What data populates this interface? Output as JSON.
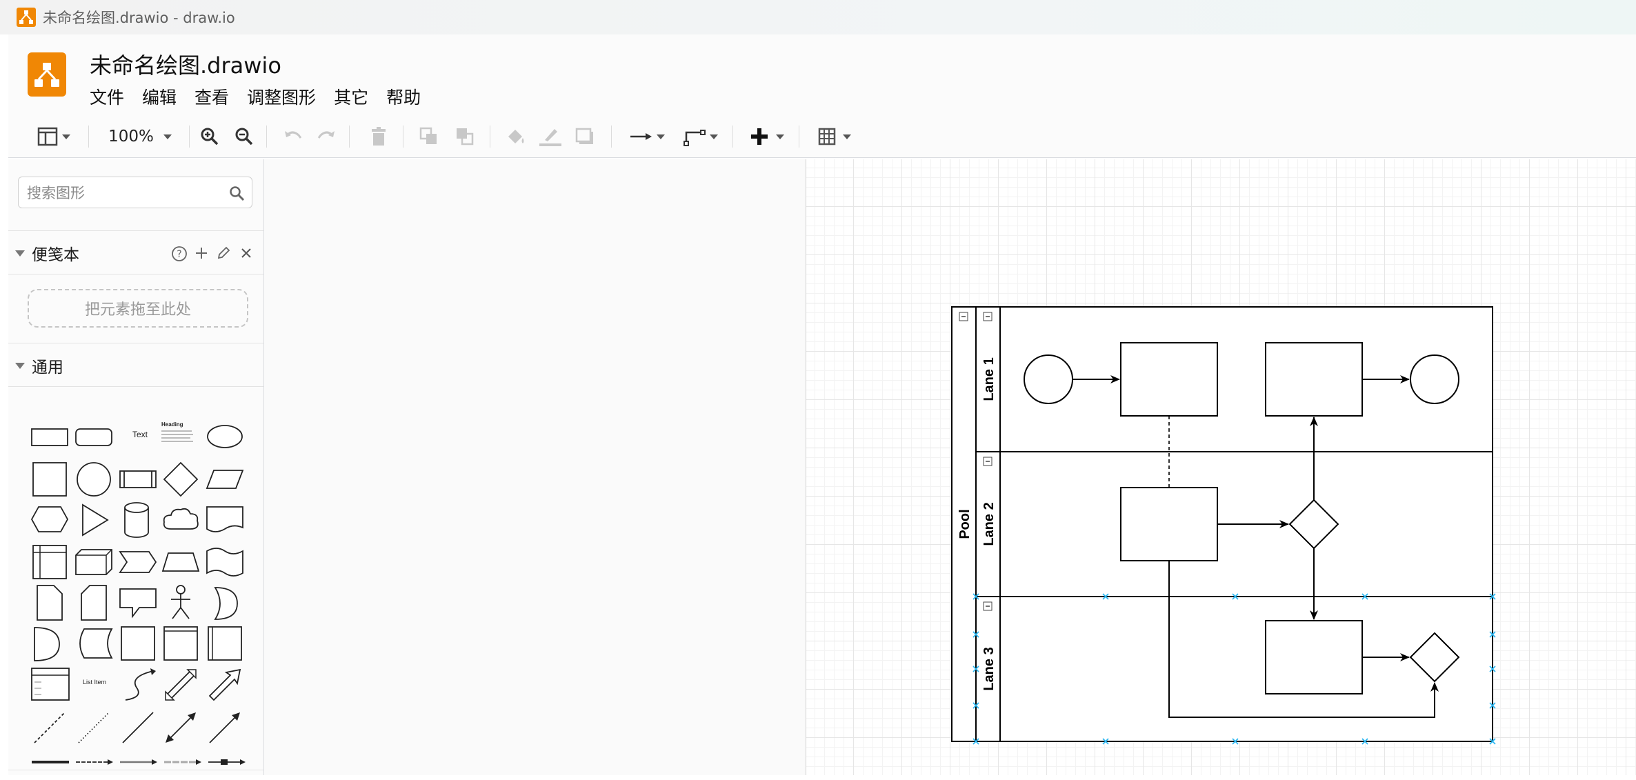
{
  "window": {
    "title": "未命名绘图.drawio - draw.io"
  },
  "header": {
    "doc_name": "未命名绘图.drawio",
    "menu": [
      "文件",
      "编辑",
      "查看",
      "调整图形",
      "其它",
      "帮助"
    ]
  },
  "toolbar": {
    "zoom": "100%",
    "icons": [
      "format-panel-icon",
      "zoom-in-icon",
      "zoom-out-icon",
      "undo-icon",
      "redo-icon",
      "delete-icon",
      "to-front-icon",
      "to-back-icon",
      "fill-color-icon",
      "line-color-icon",
      "shadow-icon",
      "connection-icon",
      "waypoints-icon",
      "insert-plus-icon",
      "table-icon"
    ]
  },
  "sidebar": {
    "search_placeholder": "搜索图形",
    "scratchpad": {
      "label": "便笺本",
      "drop_hint": "把元素拖至此处"
    },
    "general": {
      "label": "通用"
    },
    "shape_texts": {
      "text": "Text",
      "heading": "Heading",
      "list_item": "List Item"
    }
  },
  "diagram": {
    "pool_label": "Pool",
    "lanes": [
      "Lane 1",
      "Lane 2",
      "Lane 3"
    ]
  },
  "colors": {
    "logo": "#f08705",
    "selection_handle": "#29b6f2"
  }
}
